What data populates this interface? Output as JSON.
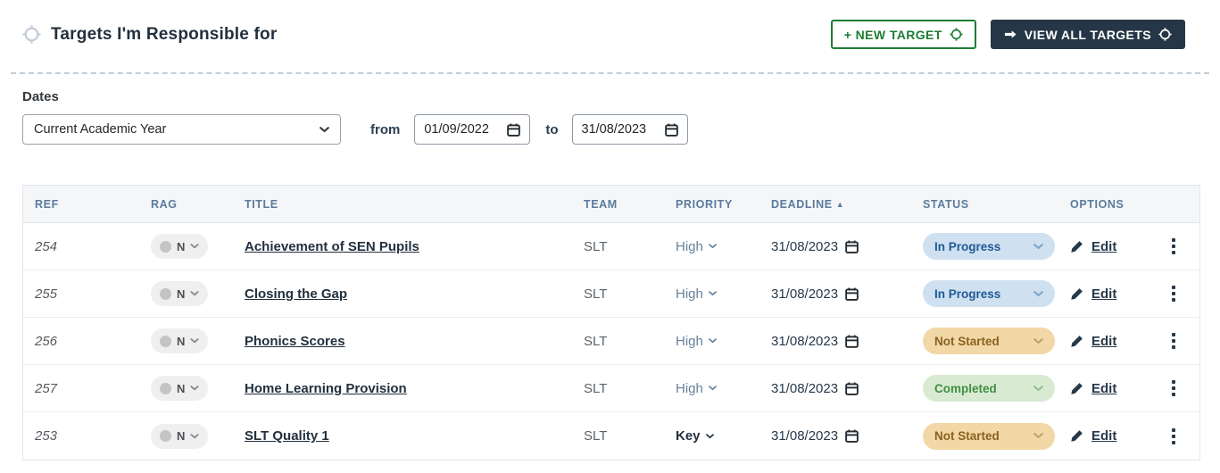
{
  "page": {
    "title": "Targets I'm Responsible for"
  },
  "actions": {
    "new_target_label": "+ NEW TARGET",
    "view_all_label": "VIEW ALL TARGETS"
  },
  "filters": {
    "section_label": "Dates",
    "date_range_selected": "Current Academic Year",
    "from_label": "from",
    "from_value": "01/09/2022",
    "to_label": "to",
    "to_value": "31/08/2023"
  },
  "table": {
    "headers": {
      "ref": "REF",
      "rag": "RAG",
      "title": "TITLE",
      "team": "TEAM",
      "priority": "PRIORITY",
      "deadline": "DEADLINE",
      "status": "STATUS",
      "options": "OPTIONS"
    },
    "sort": {
      "column": "DEADLINE",
      "direction": "ascending",
      "indicator": "▲"
    },
    "edit_label": "Edit",
    "rows": [
      {
        "ref": "254",
        "rag": "N",
        "title": "Achievement of SEN Pupils",
        "team": "SLT",
        "priority": "High",
        "deadline": "31/08/2023",
        "status": "In Progress"
      },
      {
        "ref": "255",
        "rag": "N",
        "title": "Closing the Gap",
        "team": "SLT",
        "priority": "High",
        "deadline": "31/08/2023",
        "status": "In Progress"
      },
      {
        "ref": "256",
        "rag": "N",
        "title": "Phonics Scores",
        "team": "SLT",
        "priority": "High",
        "deadline": "31/08/2023",
        "status": "Not Started"
      },
      {
        "ref": "257",
        "rag": "N",
        "title": "Home Learning Provision",
        "team": "SLT",
        "priority": "High",
        "deadline": "31/08/2023",
        "status": "Completed"
      },
      {
        "ref": "253",
        "rag": "N",
        "title": "SLT Quality 1",
        "team": "SLT",
        "priority": "Key",
        "deadline": "31/08/2023",
        "status": "Not Started"
      }
    ]
  },
  "icons": {
    "header": "target-crosshair",
    "buttons": [
      "target-crosshair",
      "right-arrow"
    ],
    "row": [
      "chevron-down",
      "calendar",
      "pencil",
      "kebab-menu"
    ]
  },
  "colors": {
    "accent_green": "#1e7e34",
    "navy_button_bg": "#253746",
    "table_header_text": "#5b7b9c",
    "status_in_progress_bg": "#cfe0f0",
    "status_in_progress_text": "#1f5a96",
    "status_not_started_bg": "#f2d7a7",
    "status_not_started_text": "#8a6220",
    "status_completed_bg": "#d9ead3",
    "status_completed_text": "#3f8f44"
  }
}
